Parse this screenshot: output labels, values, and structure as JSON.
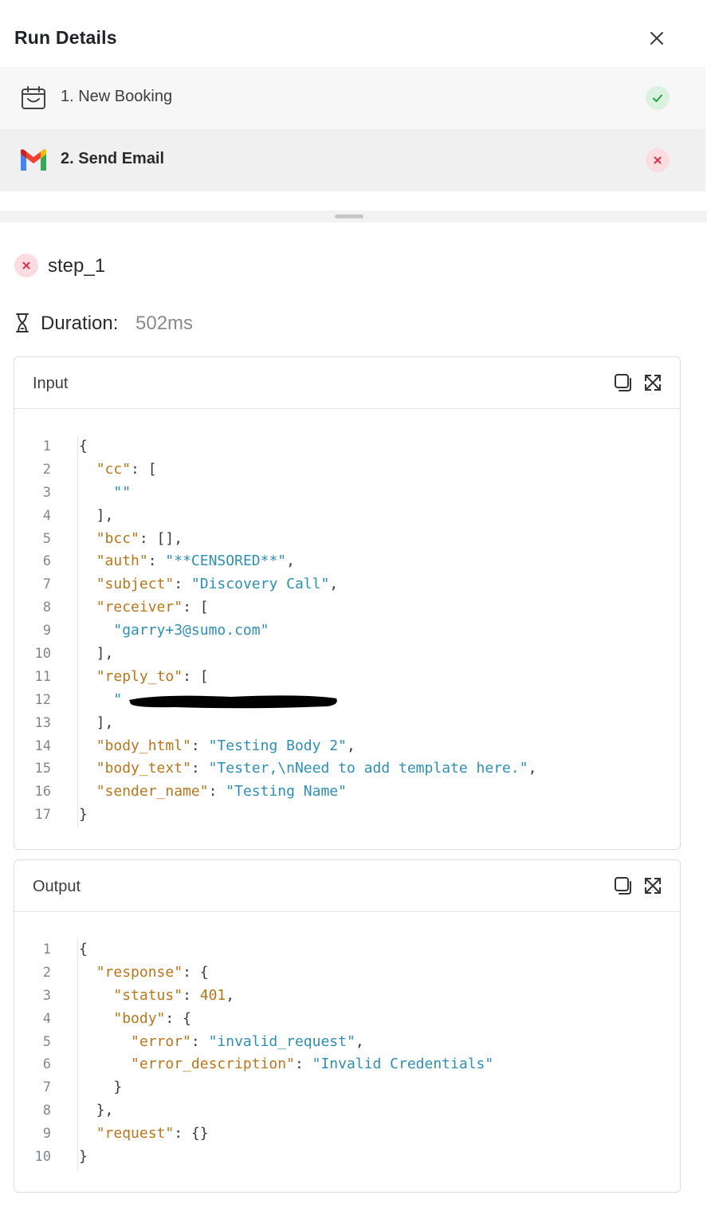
{
  "header": {
    "title": "Run Details"
  },
  "steps": [
    {
      "label": "1. New Booking",
      "icon": "calendar-icon",
      "status": "success"
    },
    {
      "label": "2. Send Email",
      "icon": "gmail-icon",
      "status": "failed"
    }
  ],
  "detail": {
    "step_name": "step_1",
    "duration_label": "Duration:",
    "duration_value": "502ms"
  },
  "input": {
    "title": "Input",
    "lines": [
      {
        "n": "1",
        "parts": [
          [
            "p",
            "{"
          ]
        ]
      },
      {
        "n": "2",
        "parts": [
          [
            "p",
            "  "
          ],
          [
            "k",
            "\"cc\""
          ],
          [
            "p",
            ": ["
          ]
        ]
      },
      {
        "n": "3",
        "parts": [
          [
            "p",
            "    "
          ],
          [
            "s",
            "\"\""
          ]
        ]
      },
      {
        "n": "4",
        "parts": [
          [
            "p",
            "  ],"
          ]
        ]
      },
      {
        "n": "5",
        "parts": [
          [
            "p",
            "  "
          ],
          [
            "k",
            "\"bcc\""
          ],
          [
            "p",
            ": [],"
          ]
        ]
      },
      {
        "n": "6",
        "parts": [
          [
            "p",
            "  "
          ],
          [
            "k",
            "\"auth\""
          ],
          [
            "p",
            ": "
          ],
          [
            "s",
            "\"**CENSORED**\""
          ],
          [
            "p",
            ","
          ]
        ]
      },
      {
        "n": "7",
        "parts": [
          [
            "p",
            "  "
          ],
          [
            "k",
            "\"subject\""
          ],
          [
            "p",
            ": "
          ],
          [
            "s",
            "\"Discovery Call\""
          ],
          [
            "p",
            ","
          ]
        ]
      },
      {
        "n": "8",
        "parts": [
          [
            "p",
            "  "
          ],
          [
            "k",
            "\"receiver\""
          ],
          [
            "p",
            ": ["
          ]
        ]
      },
      {
        "n": "9",
        "parts": [
          [
            "p",
            "    "
          ],
          [
            "s",
            "\"garry+3@sumo.com\""
          ]
        ]
      },
      {
        "n": "10",
        "parts": [
          [
            "p",
            "  ],"
          ]
        ]
      },
      {
        "n": "11",
        "parts": [
          [
            "p",
            "  "
          ],
          [
            "k",
            "\"reply_to\""
          ],
          [
            "p",
            ": ["
          ]
        ]
      },
      {
        "n": "12",
        "parts": [
          [
            "p",
            "    "
          ],
          [
            "s",
            "\""
          ]
        ]
      },
      {
        "n": "13",
        "parts": [
          [
            "p",
            "  ],"
          ]
        ]
      },
      {
        "n": "14",
        "parts": [
          [
            "p",
            "  "
          ],
          [
            "k",
            "\"body_html\""
          ],
          [
            "p",
            ": "
          ],
          [
            "s",
            "\"Testing Body 2\""
          ],
          [
            "p",
            ","
          ]
        ]
      },
      {
        "n": "15",
        "parts": [
          [
            "p",
            "  "
          ],
          [
            "k",
            "\"body_text\""
          ],
          [
            "p",
            ": "
          ],
          [
            "s",
            "\"Tester,\\nNeed to add template here.\""
          ],
          [
            "p",
            ","
          ]
        ]
      },
      {
        "n": "16",
        "parts": [
          [
            "p",
            "  "
          ],
          [
            "k",
            "\"sender_name\""
          ],
          [
            "p",
            ": "
          ],
          [
            "s",
            "\"Testing Name\""
          ]
        ]
      },
      {
        "n": "17",
        "parts": [
          [
            "p",
            "}"
          ]
        ]
      }
    ]
  },
  "output": {
    "title": "Output",
    "lines": [
      {
        "n": "1",
        "parts": [
          [
            "p",
            "{"
          ]
        ]
      },
      {
        "n": "2",
        "parts": [
          [
            "p",
            "  "
          ],
          [
            "k",
            "\"response\""
          ],
          [
            "p",
            ": {"
          ]
        ]
      },
      {
        "n": "3",
        "parts": [
          [
            "p",
            "    "
          ],
          [
            "k",
            "\"status\""
          ],
          [
            "p",
            ": "
          ],
          [
            "n",
            "401"
          ],
          [
            "p",
            ","
          ]
        ]
      },
      {
        "n": "4",
        "parts": [
          [
            "p",
            "    "
          ],
          [
            "k",
            "\"body\""
          ],
          [
            "p",
            ": {"
          ]
        ]
      },
      {
        "n": "5",
        "parts": [
          [
            "p",
            "      "
          ],
          [
            "k",
            "\"error\""
          ],
          [
            "p",
            ": "
          ],
          [
            "s",
            "\"invalid_request\""
          ],
          [
            "p",
            ","
          ]
        ]
      },
      {
        "n": "6",
        "parts": [
          [
            "p",
            "      "
          ],
          [
            "k",
            "\"error_description\""
          ],
          [
            "p",
            ": "
          ],
          [
            "s",
            "\"Invalid Credentials\""
          ]
        ]
      },
      {
        "n": "7",
        "parts": [
          [
            "p",
            "    }"
          ]
        ]
      },
      {
        "n": "8",
        "parts": [
          [
            "p",
            "  },"
          ]
        ]
      },
      {
        "n": "9",
        "parts": [
          [
            "p",
            "  "
          ],
          [
            "k",
            "\"request\""
          ],
          [
            "p",
            ": {}"
          ]
        ]
      },
      {
        "n": "10",
        "parts": [
          [
            "p",
            "}"
          ]
        ]
      }
    ]
  },
  "colors": {
    "success": "#22a046",
    "failure": "#e0314a",
    "json_key": "#b8761c",
    "json_string": "#2f8fb3"
  }
}
